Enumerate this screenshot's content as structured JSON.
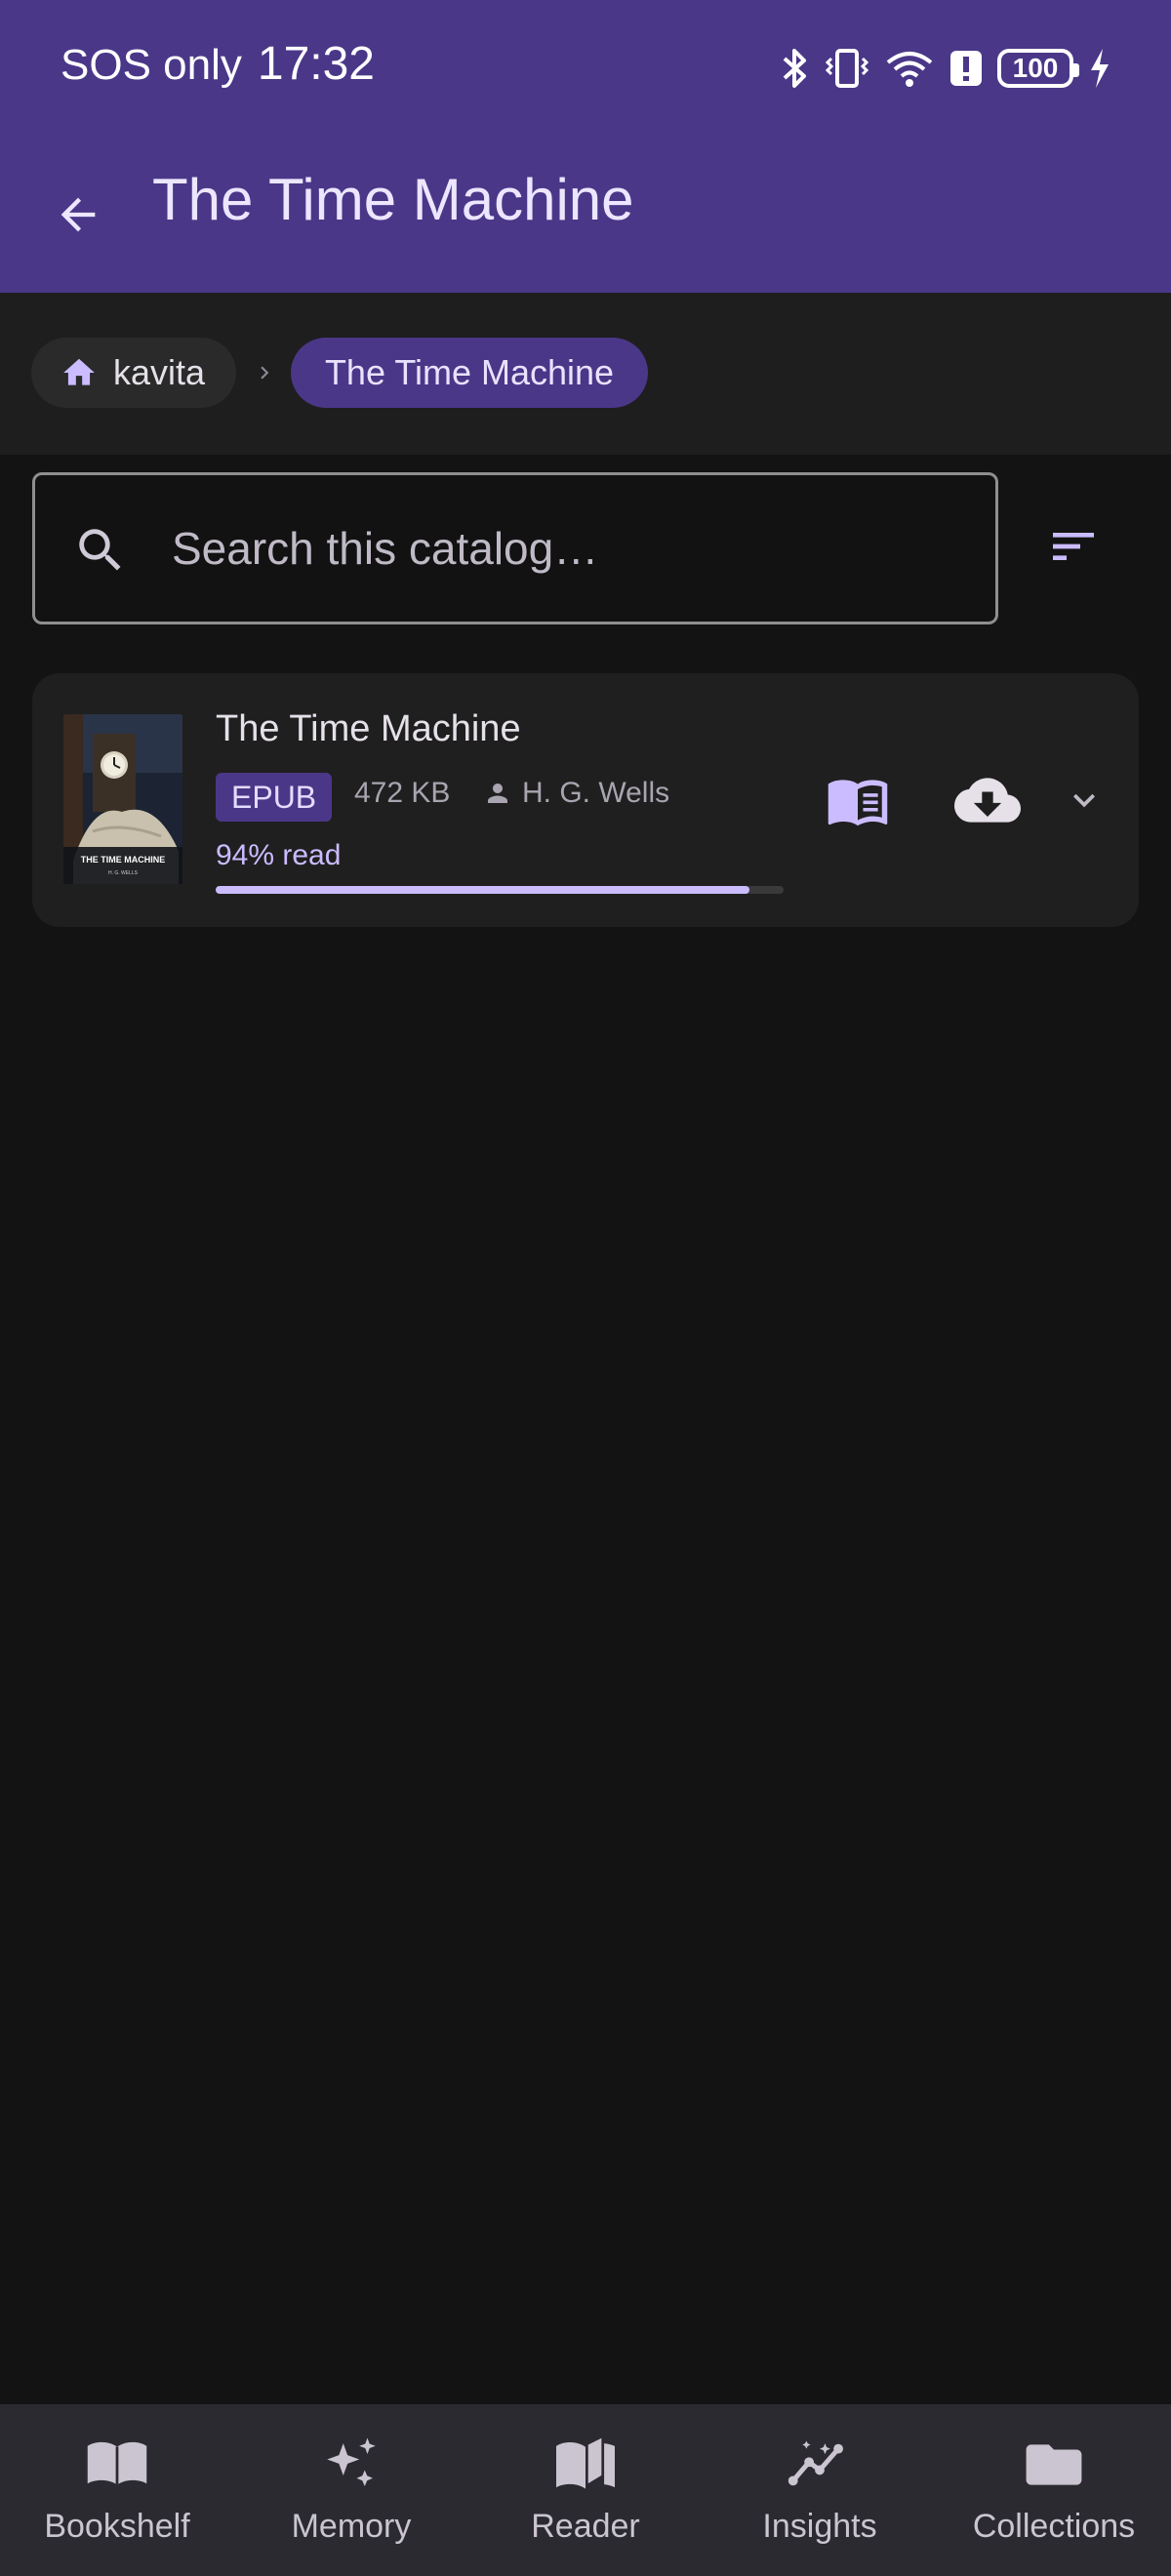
{
  "status_bar": {
    "carrier": "SOS only",
    "time": "17:32",
    "battery": "100"
  },
  "app_bar": {
    "title": "The Time Machine"
  },
  "breadcrumb": {
    "home_label": "kavita",
    "current_label": "The Time Machine"
  },
  "search": {
    "placeholder": "Search this catalog…",
    "value": ""
  },
  "book": {
    "title": "The Time Machine",
    "format": "EPUB",
    "size": "472 KB",
    "author": "H. G. Wells",
    "progress_label": "94% read",
    "progress": 0.94,
    "cover_title": "THE TIME MACHINE",
    "cover_author": "H. G. WELLS"
  },
  "bottom_nav": [
    {
      "label": "Bookshelf",
      "icon": "open-book-icon"
    },
    {
      "label": "Memory",
      "icon": "sparkle-icon"
    },
    {
      "label": "Reader",
      "icon": "reader-book-icon"
    },
    {
      "label": "Insights",
      "icon": "insights-icon"
    },
    {
      "label": "Collections",
      "icon": "folder-icon"
    }
  ],
  "colors": {
    "primary": "#4a3788",
    "accent": "#cbbcff",
    "background": "#131313",
    "surface": "#1f1f1f"
  }
}
